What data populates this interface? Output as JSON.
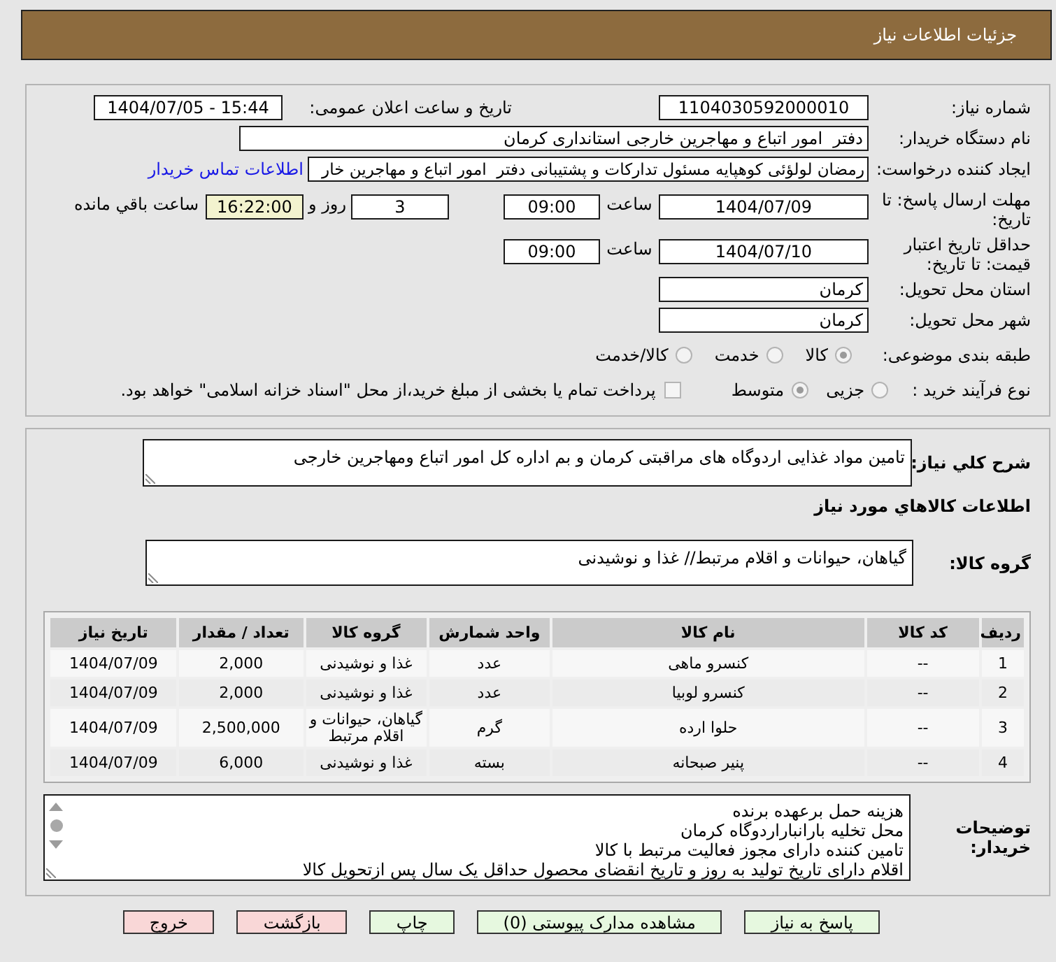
{
  "header": {
    "title": "جزئیات اطلاعات نیاز"
  },
  "details": {
    "need_number": {
      "label": "شماره نیاز:",
      "value": "1104030592000010"
    },
    "announcement": {
      "label": "تاریخ و ساعت اعلان عمومی:",
      "value": "1404/07/05 - 15:44"
    },
    "buyer_org": {
      "label": "نام دستگاه خریدار:",
      "value": "دفتر  امور اتباع و مهاجرین خارجی استانداری کرمان"
    },
    "requester": {
      "label": "ایجاد کننده درخواست:",
      "value": "رمضان لولؤئی کوهپایه مسئول تدارکات و پشتیبانی دفتر  امور اتباع و مهاجرین خار",
      "link": "اطلاعات تماس خریدار"
    },
    "reply_deadline": {
      "label": "مهلت ارسال پاسخ: تا تاریخ:",
      "date": "1404/07/09",
      "time_label": "ساعت",
      "time": "09:00",
      "days": "3",
      "days_label": "روز و",
      "remaining": "16:22:00",
      "remaining_label": "ساعت باقي مانده"
    },
    "price_validity": {
      "label": "حداقل تاریخ اعتبار قیمت: تا تاریخ:",
      "date": "1404/07/10",
      "time_label": "ساعت",
      "time": "09:00"
    },
    "delivery_province": {
      "label": "استان محل تحویل:",
      "value": "کرمان"
    },
    "delivery_city": {
      "label": "شهر محل تحویل:",
      "value": "کرمان"
    },
    "subject_category": {
      "label": "طبقه بندی موضوعی:",
      "options": [
        {
          "label": "کالا",
          "selected": true
        },
        {
          "label": "خدمت",
          "selected": false
        },
        {
          "label": "کالا/خدمت",
          "selected": false
        }
      ]
    },
    "purchase_process": {
      "label": "نوع فرآیند خرید :",
      "options": [
        {
          "label": "جزیی",
          "selected": false
        },
        {
          "label": "متوسط",
          "selected": true
        }
      ],
      "treasury_payment": {
        "label": "پرداخت تمام یا بخشی از مبلغ خرید،از محل \"اسناد خزانه اسلامی\" خواهد بود.",
        "checked": false
      }
    }
  },
  "description": {
    "label": "شرح کلي نیاز:",
    "value": "تامین مواد غذایی اردوگاه های مراقبتی کرمان و بم اداره کل امور اتباع ومهاجرین خارجی"
  },
  "goods": {
    "title": "اطلاعات کالاهاي مورد نیاز",
    "group_label": "گروه کالا:",
    "group_value": "گیاهان، حیوانات و اقلام مرتبط// غذا و نوشیدنی"
  },
  "table": {
    "columns": [
      "ردیف",
      "کد کالا",
      "نام کالا",
      "واحد شمارش",
      "گروه کالا",
      "تعداد / مقدار",
      "تاریخ نیاز"
    ],
    "rows": [
      [
        "1",
        "--",
        "کنسرو ماهی",
        "عدد",
        "غذا و نوشیدنی",
        "2,000",
        "1404/07/09"
      ],
      [
        "2",
        "--",
        "کنسرو لوبیا",
        "عدد",
        "غذا و نوشیدنی",
        "2,000",
        "1404/07/09"
      ],
      [
        "3",
        "--",
        "حلوا ارده",
        "گرم",
        "گیاهان، حیوانات و اقلام مرتبط",
        "2,500,000",
        "1404/07/09"
      ],
      [
        "4",
        "--",
        "پنیر صبحانه",
        "بسته",
        "غذا و نوشیدنی",
        "6,000",
        "1404/07/09"
      ]
    ]
  },
  "buyer_notes": {
    "label": "توضیحات خریدار:",
    "lines": [
      "هزینه حمل برعهده برنده",
      "محل تخلیه بارانباراردوگاه کرمان",
      "تامین کننده دارای مجوز فعالیت مرتبط با کالا",
      "اقلام دارای تاریخ تولید به روز و تاریخ انقضای محصول حداقل یک سال پس ازتحویل کالا"
    ]
  },
  "buttons": [
    {
      "label": "پاسخ به نیاز",
      "kind": "action"
    },
    {
      "label": "مشاهده مدارک پیوستی (0)",
      "kind": "action"
    },
    {
      "label": "چاپ",
      "kind": "action"
    },
    {
      "label": "بازگشت",
      "kind": "exit"
    },
    {
      "label": "خروج",
      "kind": "exit"
    }
  ]
}
